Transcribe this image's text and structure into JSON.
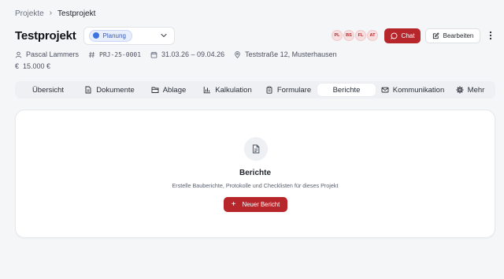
{
  "breadcrumb": {
    "parent": "Projekte",
    "separator": "›",
    "current": "Testprojekt"
  },
  "project": {
    "title": "Testprojekt",
    "status": "Planung",
    "owner": "Pascal Lammers",
    "number": "PRJ-25-0001",
    "period": "31.03.26 – 09.04.26",
    "address": "Teststraße 12, Musterhausen",
    "budget": "15.000 €",
    "budget_symbol": "€"
  },
  "team": [
    "PL",
    "BS",
    "FL",
    "AT"
  ],
  "actions": {
    "chat": "Chat",
    "edit": "Bearbeiten"
  },
  "tabs": [
    {
      "label": "Übersicht",
      "icon": "none"
    },
    {
      "label": "Dokumente",
      "icon": "document-icon"
    },
    {
      "label": "Ablage",
      "icon": "folder-icon"
    },
    {
      "label": "Kalkulation",
      "icon": "bar-chart-icon"
    },
    {
      "label": "Formulare",
      "icon": "clipboard-icon"
    },
    {
      "label": "Berichte",
      "icon": "none",
      "active": true
    },
    {
      "label": "Kommunikation",
      "icon": "mail-icon"
    },
    {
      "label": "Mehr",
      "icon": "gear-icon"
    }
  ],
  "empty_state": {
    "title": "Berichte",
    "description": "Erstelle Bauberichte, Protokolle und Checklisten für dieses Projekt",
    "button": "Neuer Bericht",
    "button_icon": "+"
  },
  "colors": {
    "accent": "#b7262b",
    "status": "#3b74e0",
    "background": "#f5f6f8"
  }
}
